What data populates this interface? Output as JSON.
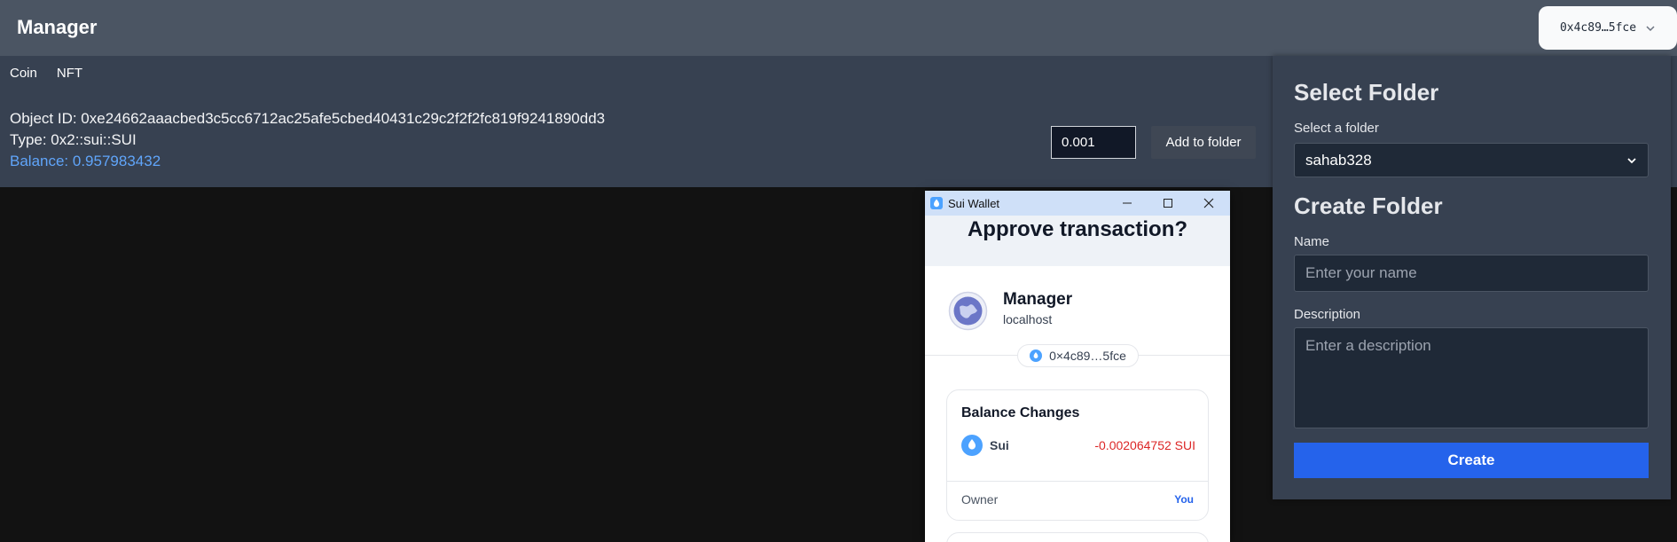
{
  "header": {
    "title": "Manager",
    "account_label": "0x4c89…5fce"
  },
  "tabs": [
    {
      "label": "Coin"
    },
    {
      "label": "NFT"
    }
  ],
  "coin": {
    "object_id": "Object ID: 0xe24662aaacbed3c5cc6712ac25afe5cbed40431c29c2f2f2fc819f9241890dd3",
    "type": "Type: 0x2::sui::SUI",
    "balance": "Balance: 0.957983432",
    "amount_value": "0.001",
    "add_button": "Add to folder"
  },
  "folder_panel": {
    "select_heading": "Select Folder",
    "select_label": "Select a folder",
    "selected_folder": "sahab328",
    "create_heading": "Create Folder",
    "name_label": "Name",
    "name_placeholder": "Enter your name",
    "description_label": "Description",
    "description_placeholder": "Enter a description",
    "create_button": "Create"
  },
  "wallet": {
    "window_title": "Sui Wallet",
    "heading": "Approve transaction?",
    "dapp_name": "Manager",
    "dapp_host": "localhost",
    "address": "0×4c89…5fce",
    "balance_changes_title": "Balance Changes",
    "coin_name": "Sui",
    "coin_change": "-0.002064752 SUI",
    "owner_label": "Owner",
    "owner_value": "You"
  },
  "colors": {
    "header_bg": "#4b5563",
    "content_bg": "#374151",
    "accent_blue": "#2563eb",
    "balance_blue": "#60a5fa",
    "negative_red": "#dc2626"
  }
}
